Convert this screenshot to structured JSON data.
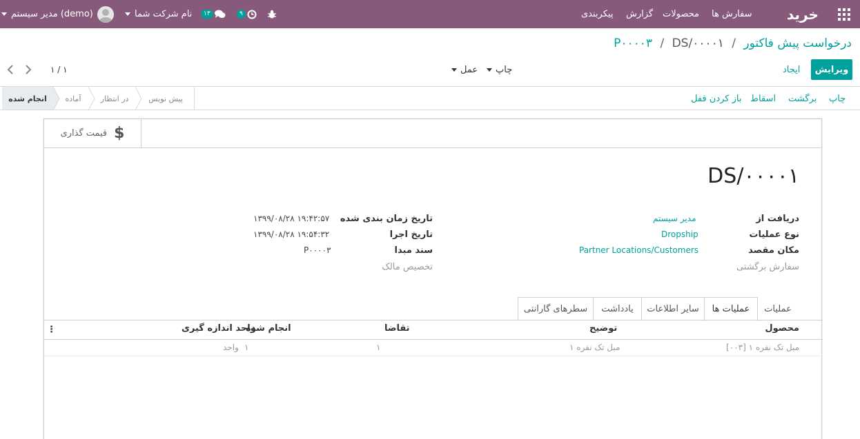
{
  "topbar": {
    "app_title": "خرید",
    "menu": [
      "سفارش ها",
      "محصولات",
      "گزارش",
      "پیکربندی"
    ],
    "user": "مدیر سیستم (demo)",
    "company": "نام شرکت شما",
    "chat_count": "۱۳",
    "activity_count": "۹",
    "colors": {
      "bar": "#875a7b",
      "badge": "#00a09d"
    }
  },
  "breadcrumb": {
    "root": "درخواست پیش فاکتور",
    "order": "P۰۰۰۰۳",
    "current": "DS/۰۰۰۰۱",
    "sep": "/"
  },
  "toolbar": {
    "edit": "ویرایش",
    "create": "ایجاد",
    "print": "چاپ",
    "action": "عمل",
    "pager": "۱ / ۱"
  },
  "statusbar": {
    "buttons": [
      "چاپ",
      "برگشت",
      "اسقاط",
      "باز کردن قفل"
    ],
    "stages": [
      "انجام شده",
      "آماده",
      "در انتظار",
      "پیش نویس"
    ]
  },
  "sheet": {
    "smart_button": "قیمت گذاری",
    "name": "DS/۰۰۰۰۱",
    "left_fields": [
      {
        "label": "دریافت از",
        "value": "مدیر سیستم"
      },
      {
        "label": "نوع عملیات",
        "value": "Dropship"
      },
      {
        "label": "مکان مقصد",
        "value": "Partner Locations/Customers"
      },
      {
        "label": "سفارش برگشتی",
        "value": ""
      }
    ],
    "right_fields": [
      {
        "label": "تاریخ زمان بندی شده",
        "value": "۱۳۹۹/۰۸/۲۸ ۱۹:۴۲:۵۷"
      },
      {
        "label": "تاریخ اجرا",
        "value": "۱۳۹۹/۰۸/۲۸ ۱۹:۵۴:۳۲"
      },
      {
        "label": "سند مبدا",
        "value": "P۰۰۰۰۳"
      },
      {
        "label": "تخصیص مالک",
        "value": ""
      }
    ],
    "tabs": [
      "عملیات",
      "عملیات ها",
      "سایر اطلاعات",
      "یادداشت",
      "سطرهای گارانتی"
    ],
    "table": {
      "headers": [
        "محصول",
        "توضیح",
        "تقاضا",
        "انجام شده",
        "واحد اندازه گیری"
      ],
      "rows": [
        [
          "[۰۰۳] مبل تک نفره ۱",
          "مبل تک نفره ۱",
          "۱",
          "۱",
          "واحد"
        ]
      ]
    }
  }
}
